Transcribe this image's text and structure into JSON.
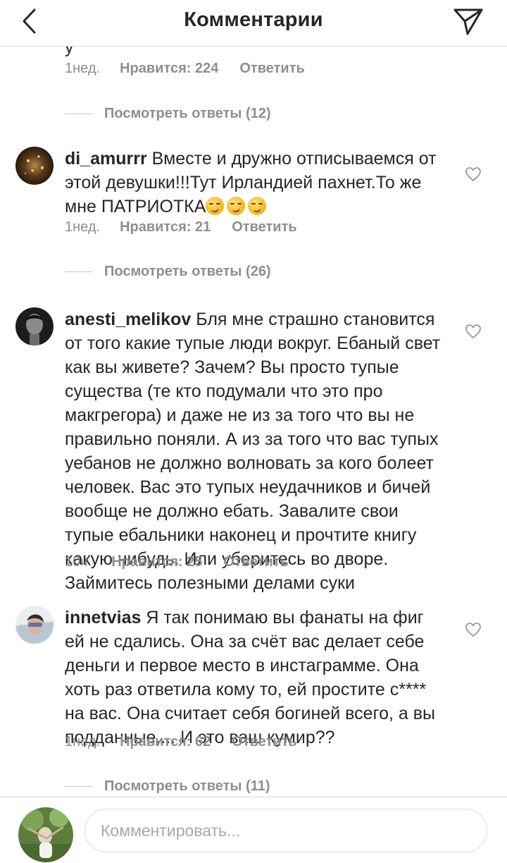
{
  "header": {
    "title": "Комментарии"
  },
  "cut_text": "у",
  "first": {
    "time": "1нед.",
    "likes": "Нравится: 224",
    "reply": "Ответить",
    "view_replies": "Посмотреть ответы (12)"
  },
  "comments": [
    {
      "username": "di_amurrr",
      "text": "Вместе и дружно отписываемся от этой девушки!!!Тут Ирландией пахнет.То же мне ПАТРИОТКА",
      "emoji": "smirk-emoji",
      "time": "1нед.",
      "likes": "Нравится: 21",
      "reply": "Ответить",
      "view_replies": "Посмотреть ответы (26)"
    },
    {
      "username": "anesti_melikov",
      "text": "Бля мне страшно становится от того какие тупые люди вокруг. Ебаный свет как вы живете? Зачем? Вы просто тупые существа (те кто подумали что это про макгрегора) и даже не из за того что вы не правильно поняли. А из за того что вас тупых уебанов не должно волновать за кого болеет человек. Вас это тупых неудачников и бичей вообще не должно ебать. Завалите свои тупые ебальники наконец и прочтите книгу какую нибудь. Или уберитесь во дворе. Займитесь полезными делами суки",
      "time": "10ч.",
      "likes": "Нравится: 25",
      "reply": "Ответить"
    },
    {
      "username": "innetvias",
      "text": "Я так понимаю вы фанаты на фиг ей не сдались.  Она за счёт вас делает себе деньги и первое место в инстаграмме. Она хоть раз ответила кому то, ей простите с**** на вас. Она считает себя богиней всего, а вы подданные,... И это ваш кумир??",
      "time": "1нед.",
      "likes": "Нравится: 62",
      "reply": "Ответить",
      "view_replies": "Посмотреть ответы (11)"
    }
  ],
  "composer": {
    "placeholder": "Комментировать..."
  },
  "icons": {
    "back": "chevron-left-icon",
    "share": "paper-plane-icon",
    "like": "heart-icon"
  }
}
